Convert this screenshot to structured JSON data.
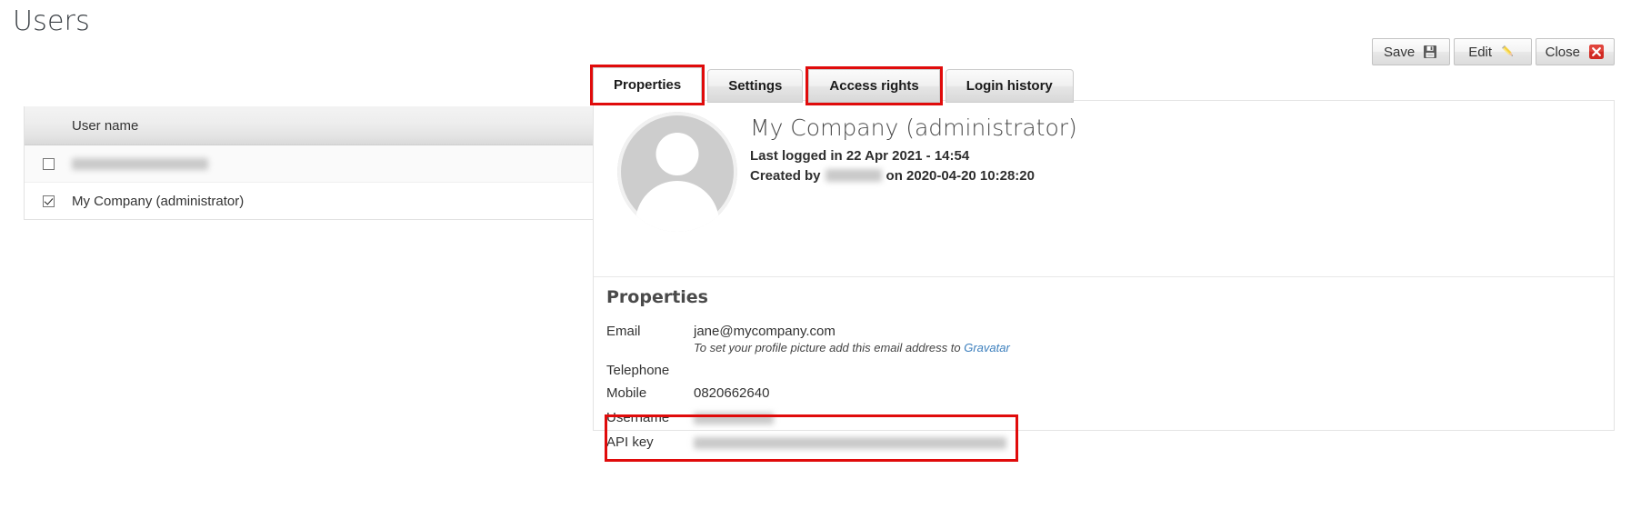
{
  "page": {
    "title": "Users"
  },
  "users_table": {
    "columns": [
      "",
      "User name"
    ],
    "rows": [
      {
        "checked": false,
        "name": "",
        "redacted": true,
        "redacted_width": 150
      },
      {
        "checked": true,
        "name": "My Company (administrator)",
        "redacted": false
      }
    ]
  },
  "toolbar": {
    "buttons": [
      {
        "label": "Save",
        "icon": "floppy-disk-icon"
      },
      {
        "label": "Edit",
        "icon": "pencil-icon"
      },
      {
        "label": "Close",
        "icon": "close-red-x-icon"
      }
    ]
  },
  "tabs": [
    {
      "label": "Properties",
      "active": true,
      "highlighted": true
    },
    {
      "label": "Settings",
      "active": false,
      "highlighted": false
    },
    {
      "label": "Access rights",
      "active": false,
      "highlighted": true
    },
    {
      "label": "Login history",
      "active": false,
      "highlighted": false
    }
  ],
  "profile": {
    "avatar_icon": "user-avatar-placeholder-icon",
    "name": "My Company (administrator)",
    "last_logged_in_label": "Last logged in 22 Apr 2021 - 14:54",
    "created_by_prefix": "Created by",
    "created_by_value_redacted": true,
    "created_by_suffix": "on 2020-04-20 10:28:20"
  },
  "properties": {
    "heading": "Properties",
    "fields": [
      {
        "label": "Email",
        "value": "jane@mycompany.com",
        "redacted": false
      },
      {
        "label": "Telephone",
        "value": "",
        "redacted": false
      },
      {
        "label": "Mobile",
        "value": "0820662640",
        "redacted": false
      },
      {
        "label": "Username",
        "value": "",
        "redacted": true,
        "redacted_width": 88
      },
      {
        "label": "API key",
        "value": "",
        "redacted": true,
        "redacted_width": 344
      }
    ],
    "email_hint_prefix": "To set your profile picture add this email address to ",
    "email_hint_link": "Gravatar"
  },
  "colors": {
    "highlight_red": "#e00b0b",
    "link_blue": "#3c7fbd",
    "text_dark": "#333333",
    "panel_border": "#e4e4e4"
  }
}
